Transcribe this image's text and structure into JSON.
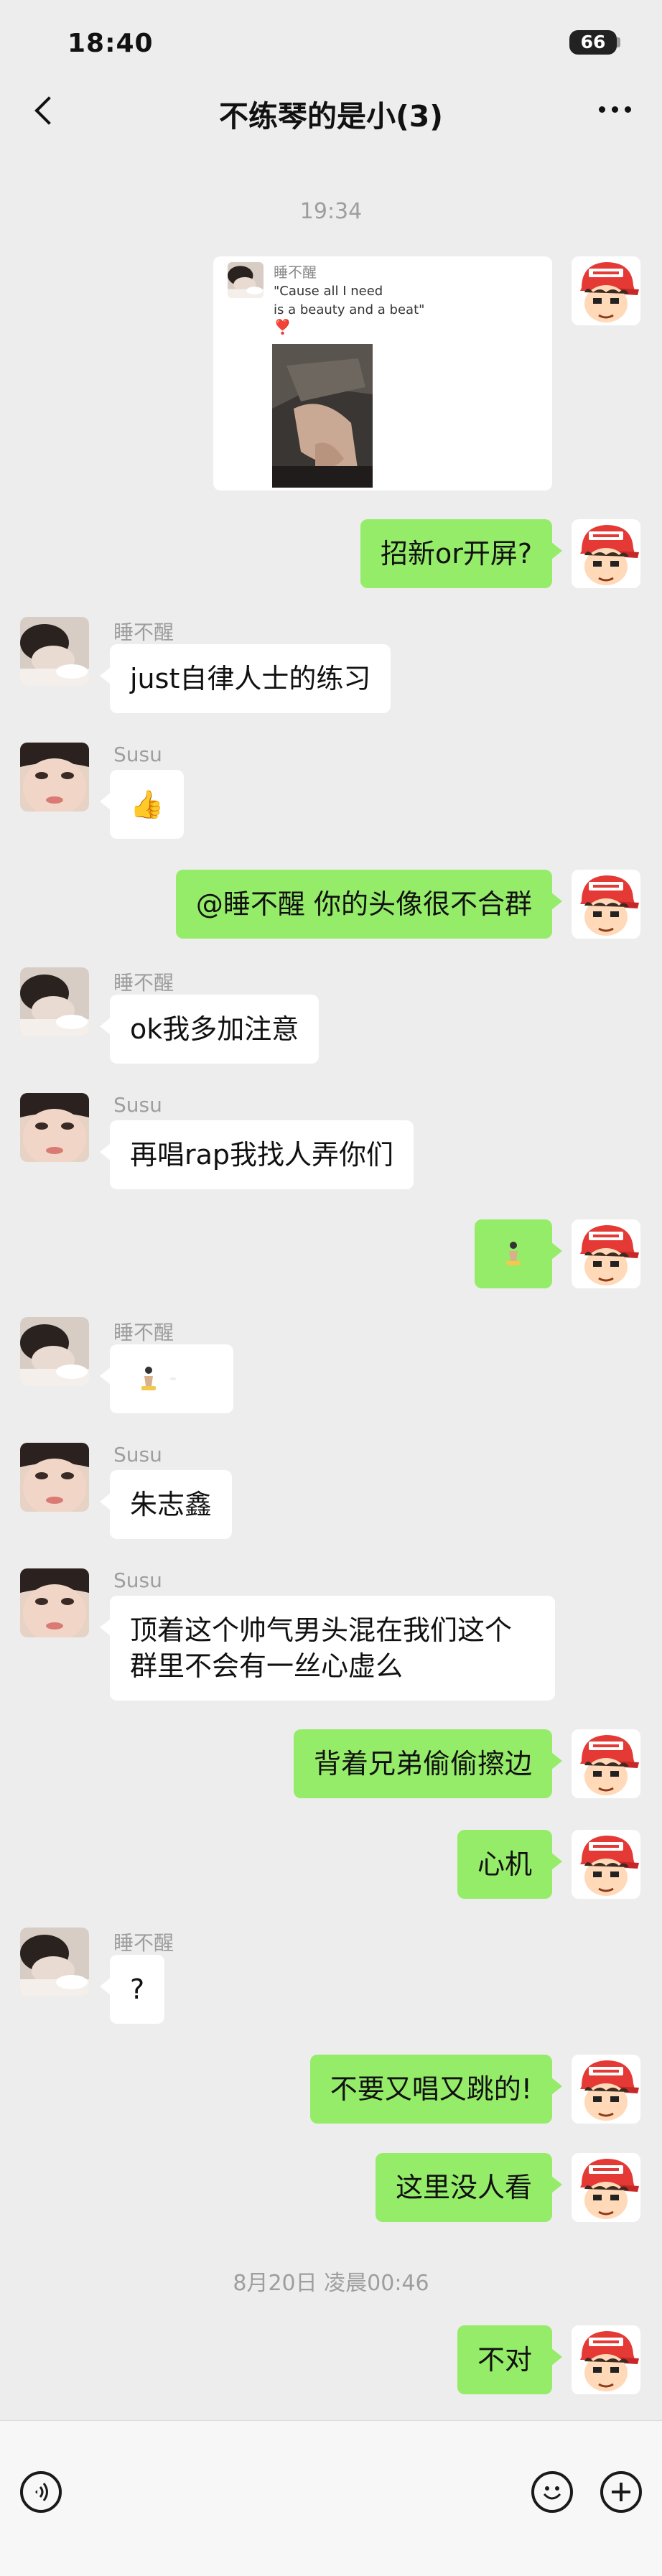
{
  "status": {
    "time": "18:40",
    "battery": "66"
  },
  "nav": {
    "title": "不练琴的是小(3)"
  },
  "stamps": {
    "first": "19:34",
    "second": "8月20日 凌晨00:46"
  },
  "card": {
    "name": "睡不醒",
    "text": "\"Cause all I need\nis a beauty and a beat\"",
    "heart": "❣️"
  },
  "senders": {
    "a": "睡不醒",
    "b": "Susu"
  },
  "messages": {
    "m1": "招新or开屏?",
    "m2": "just自律人士的练习",
    "m3": "👍",
    "m4": "@睡不醒 你的头像很不合群",
    "m5": "ok我多加注意",
    "m6": "再唱rap我找人弄你们",
    "m9": "朱志鑫",
    "m10": "顶着这个帅气男头混在我们这个群里不会有一丝心虚么",
    "m11": "背着兄弟偷偷擦边",
    "m12": "心机",
    "m13": "?",
    "m14": "不要又唱又跳的!",
    "m15": "这里没人看",
    "m16": "不对"
  },
  "avatars": {
    "self": "red-cap-cartoon-avatar",
    "shuibuxing": "person-lying-avatar",
    "susu": "face-closeup-avatar"
  },
  "colors": {
    "bg": "#ededed",
    "outgoing": "#95ec69",
    "incoming": "#ffffff"
  }
}
